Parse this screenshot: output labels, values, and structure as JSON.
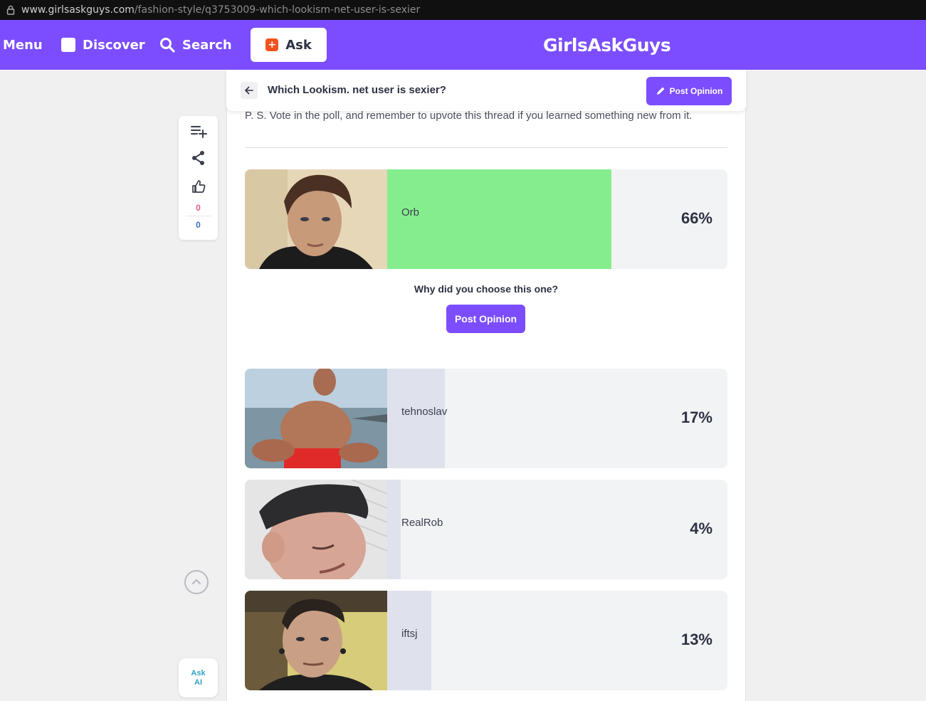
{
  "browser": {
    "url_domain": "www.girlsaskguys.com",
    "url_path": "/fashion-style/q3753009-which-lookism-net-user-is-sexier"
  },
  "nav": {
    "menu_label": "Menu",
    "discover_label": "Discover",
    "search_label": "Search",
    "ask_label": "Ask",
    "logo_text": "GirlsAskGuys",
    "brand_color": "#7c4dff"
  },
  "question": {
    "title": "Which Lookism. net user is sexier?",
    "post_opinion_label": "Post Opinion",
    "ps_text": "P. S. Vote in the poll, and remember to upvote this thread if you learned something new from it."
  },
  "poll": {
    "options": [
      {
        "name": "Orb",
        "percent_label": "66%",
        "percent": 66,
        "selected": true,
        "bar_color": "#86ed8e"
      },
      {
        "name": "tehnoslav",
        "percent_label": "17%",
        "percent": 17,
        "selected": false,
        "bar_color": "#dfe2ec"
      },
      {
        "name": "RealRob",
        "percent_label": "4%",
        "percent": 4,
        "selected": false,
        "bar_color": "#dfe2ec"
      },
      {
        "name": "iftsj",
        "percent_label": "13%",
        "percent": 13,
        "selected": false,
        "bar_color": "#dfe2ec"
      }
    ],
    "why_text": "Why did you choose this one?",
    "why_button_label": "Post Opinion"
  },
  "sidebar": {
    "upvotes": "0",
    "downvotes": "0",
    "ask_ai_line1": "Ask",
    "ask_ai_line2": "AI"
  },
  "icons": [
    "lock-icon",
    "discover-icon",
    "search-icon",
    "plus-icon",
    "back-arrow-icon",
    "pencil-icon",
    "playlist-add-icon",
    "share-icon",
    "thumbs-up-icon",
    "chevron-up-icon"
  ]
}
